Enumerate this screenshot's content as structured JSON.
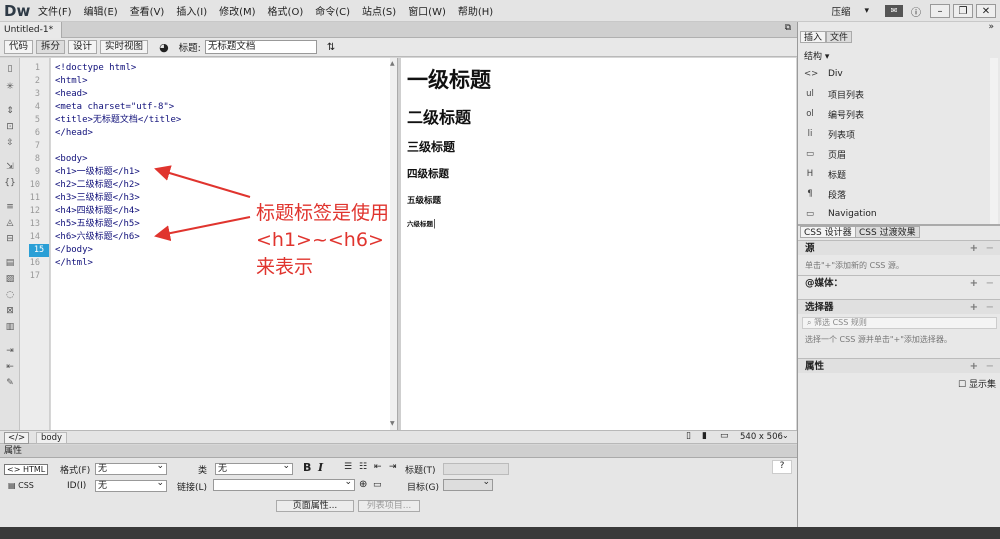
{
  "app": {
    "logo": "Dw",
    "menu": [
      "文件(F)",
      "编辑(E)",
      "查看(V)",
      "插入(I)",
      "修改(M)",
      "格式(O)",
      "命令(C)",
      "站点(S)",
      "窗口(W)",
      "帮助(H)"
    ],
    "workspace": "压缩"
  },
  "tab": {
    "name": "Untitled-1*",
    "close": "×"
  },
  "toolbar": {
    "code": "代码",
    "split": "拆分",
    "design": "设计",
    "live": "实时视图",
    "title_label": "标题:",
    "title_value": "无标题文档"
  },
  "code_lines": [
    "<!doctype html>",
    "<html>",
    "<head>",
    "<meta charset=\"utf-8\">",
    "<title>无标题文档</title>",
    "</head>",
    "",
    "<body>",
    "<h1>一级标题</h1>",
    "<h2>二级标题</h2>",
    "<h3>三级标题</h3>",
    "<h4>四级标题</h4>",
    "<h5>五级标题</h5>",
    "<h6>六级标题</h6>",
    "</body>",
    "</html>",
    ""
  ],
  "line_numbers": [
    "1",
    "2",
    "3",
    "4",
    "5",
    "6",
    "7",
    "8",
    "9",
    "10",
    "11",
    "12",
    "13",
    "14",
    "15",
    "16",
    "17"
  ],
  "current_line": "15",
  "annotation": {
    "line1": "标题标签是使用",
    "line2": "<h1>~<h6>",
    "line3": "来表示",
    "color": "#e0342e"
  },
  "design": {
    "h1": "一级标题",
    "h2": "二级标题",
    "h3": "三级标题",
    "h4": "四级标题",
    "h5": "五级标题",
    "h6": "六级标题"
  },
  "status": {
    "tag": "body",
    "size": "540 x 506"
  },
  "props": {
    "header": "属性",
    "html": "HTML",
    "css": "CSS",
    "format_label": "格式(F)",
    "format_value": "无",
    "class_label": "类",
    "class_value": "无",
    "id_label": "ID(I)",
    "id_value": "无",
    "link_label": "链接(L)",
    "heading_label": "标题(T)",
    "target_label": "目标(G)",
    "page_props": "页面属性...",
    "list_items": "列表项目..."
  },
  "right": {
    "tabs": [
      "插入",
      "文件"
    ],
    "category": "结构",
    "items": [
      {
        "icon": "<>",
        "label": "Div"
      },
      {
        "icon": "ul",
        "label": "项目列表"
      },
      {
        "icon": "ol",
        "label": "编号列表"
      },
      {
        "icon": "li",
        "label": "列表项"
      },
      {
        "icon": "▭",
        "label": "页眉"
      },
      {
        "icon": "H",
        "label": "标题"
      },
      {
        "icon": "¶",
        "label": "段落"
      },
      {
        "icon": "▭",
        "label": "Navigation"
      }
    ],
    "css_tabs": [
      "CSS 设计器",
      "CSS 过渡效果"
    ],
    "source": "源",
    "source_hint": "单击\"+\"添加新的 CSS 源。",
    "media": "@媒体：",
    "selector": "选择器",
    "filter": "筛选 CSS 规则",
    "selector_hint": "选择一个 CSS 源并单击\"+\"添加选择器。",
    "properties": "属性",
    "show_all": "显示集"
  }
}
